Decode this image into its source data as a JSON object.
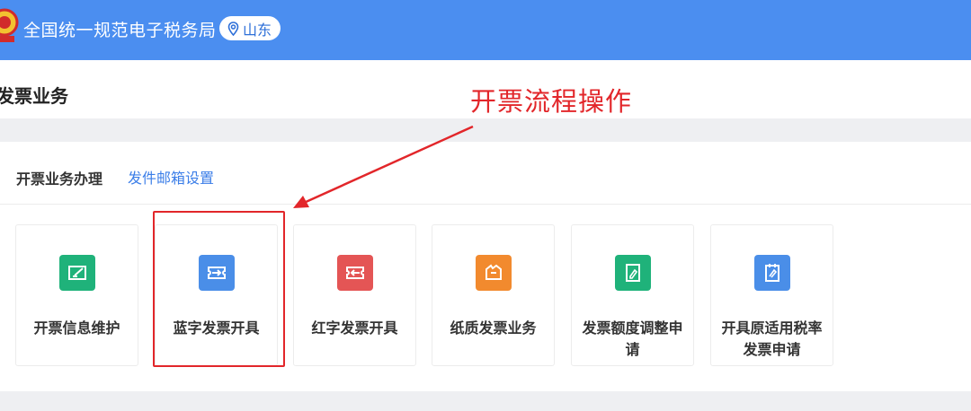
{
  "header": {
    "title": "全国统一规范电子税务局",
    "region": "山东",
    "brand_color": "#4b8ef0"
  },
  "page": {
    "title": "发票业务"
  },
  "annotation": {
    "text": "开票流程操作",
    "color": "#e2262a"
  },
  "section": {
    "title": "开票业务办理",
    "email_link": "发件邮箱设置"
  },
  "cards": [
    {
      "label": "开票信息维护",
      "icon": "edit-ticket-icon",
      "color": "#1fb27a"
    },
    {
      "label": "蓝字发票开具",
      "icon": "issue-ticket-icon",
      "color": "#4a8ee8"
    },
    {
      "label": "红字发票开具",
      "icon": "return-ticket-icon",
      "color": "#e45555"
    },
    {
      "label": "纸质发票业务",
      "icon": "paper-invoice-icon",
      "color": "#f28a2e"
    },
    {
      "label": "发票额度调整申请",
      "icon": "quota-adjust-icon",
      "color": "#1fb27a"
    },
    {
      "label": "开具原适用税率发票申请",
      "icon": "tax-rate-apply-icon",
      "color": "#4a8ee8"
    }
  ]
}
